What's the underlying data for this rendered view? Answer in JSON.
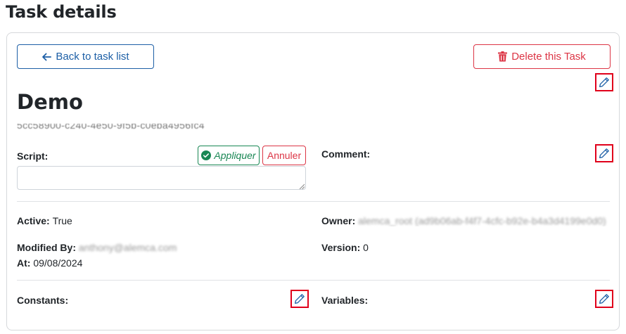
{
  "page": {
    "title": "Task details"
  },
  "toolbar": {
    "back_label": "Back to task list",
    "delete_label": "Delete this Task"
  },
  "task": {
    "name": "Demo",
    "id": "5cc58900-c240-4e50-9f5b-c0eba4956fc4"
  },
  "script": {
    "label": "Script:",
    "apply_label": "Appliquer",
    "cancel_label": "Annuler",
    "value": ""
  },
  "comment": {
    "label": "Comment:"
  },
  "info": {
    "active_label": "Active:",
    "active_value": "True",
    "owner_label": "Owner:",
    "owner_value": "alemca_root (ad9b06ab-f4f7-4cfc-b92e-b4a3d4199e0d0)",
    "modified_by_label": "Modified By:",
    "modified_by_value": "anthony@alemca.com",
    "at_label": "At:",
    "at_value": "09/08/2024",
    "version_label": "Version:",
    "version_value": "0"
  },
  "constants": {
    "label": "Constants:"
  },
  "variables": {
    "label": "Variables:"
  },
  "colors": {
    "primary": "#1d5fa6",
    "danger": "#dc3545",
    "success": "#198754",
    "highlight": "#e0001b"
  },
  "icons": {
    "back": "arrow-left-icon",
    "delete": "trash-icon",
    "apply": "check-circle-icon",
    "edit": "pencil-icon"
  }
}
